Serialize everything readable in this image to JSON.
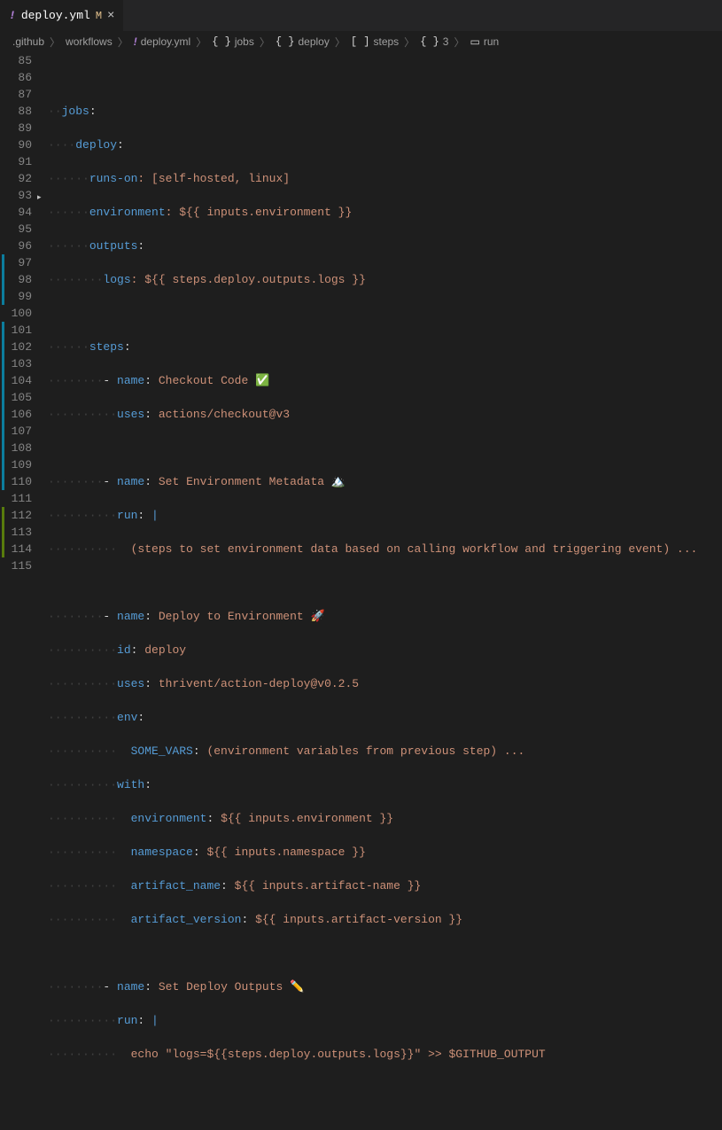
{
  "tab": {
    "icon": "!",
    "filename": "deploy.yml",
    "modified_marker": "M",
    "close": "×"
  },
  "breadcrumbs": {
    "seg1": ".github",
    "seg2": "workflows",
    "file_icon": "!",
    "seg3": "deploy.yml",
    "brace1": "{ }",
    "seg4": "jobs",
    "brace2": "{ }",
    "seg5": "deploy",
    "bracket": "[ ]",
    "seg6": "steps",
    "brace3": "{ }",
    "seg7": "3",
    "run_icon": "▭",
    "seg8": "run"
  },
  "line_numbers": [
    "85",
    "86",
    "87",
    "88",
    "89",
    "90",
    "91",
    "92",
    "93",
    "94",
    "95",
    "96",
    "97",
    "98",
    "99",
    "100",
    "101",
    "102",
    "103",
    "104",
    "105",
    "106",
    "107",
    "108",
    "109",
    "110",
    "111",
    "112",
    "113",
    "114",
    "115"
  ],
  "code": {
    "l86_key": "jobs",
    "l86_colon": ":",
    "l87_key": "deploy",
    "l87_colon": ":",
    "l88_key": "runs-on",
    "l88_val": ": [self-hosted, linux]",
    "l89_key": "environment",
    "l89_val": ": ${{ inputs.environment }}",
    "l90_key": "outputs",
    "l90_colon": ":",
    "l91_key": "logs",
    "l91_val": ": ${{ steps.deploy.outputs.logs }}",
    "l93_key": "steps",
    "l93_colon": ":",
    "l94_dash": "- ",
    "l94_key": "name",
    "l94_col": ": ",
    "l94_val": "Checkout Code ✅",
    "l95_key": "uses",
    "l95_col": ": ",
    "l95_val": "actions/checkout@v3",
    "l97_dash": "- ",
    "l97_key": "name",
    "l97_col": ": ",
    "l97_val": "Set Environment Metadata 🏔️",
    "l98_key": "run",
    "l98_col": ":",
    "l98_pipe": " |",
    "l99_val": "(steps to set environment data based on calling workflow and triggering event) ...",
    "l101_dash": "- ",
    "l101_key": "name",
    "l101_col": ": ",
    "l101_val": "Deploy to Environment 🚀",
    "l102_key": "id",
    "l102_col": ": ",
    "l102_val": "deploy",
    "l103_key": "uses",
    "l103_col": ": ",
    "l103_val": "thrivent/action-deploy@v0.2.5",
    "l104_key": "env",
    "l104_col": ":",
    "l105_key": "SOME_VARS",
    "l105_col": ": ",
    "l105_val": "(environment variables from previous step) ...",
    "l106_key": "with",
    "l106_col": ":",
    "l107_key": "environment",
    "l107_col": ": ",
    "l107_val": "${{ inputs.environment }}",
    "l108_key": "namespace",
    "l108_col": ": ",
    "l108_val": "${{ inputs.namespace }}",
    "l109_key": "artifact_name",
    "l109_col": ": ",
    "l109_val": "${{ inputs.artifact-name }}",
    "l110_key": "artifact_version",
    "l110_col": ": ",
    "l110_val": "${{ inputs.artifact-version }}",
    "l112_dash": "- ",
    "l112_key": "name",
    "l112_col": ": ",
    "l112_val": "Set Deploy Outputs ✏️",
    "l113_key": "run",
    "l113_col": ":",
    "l113_pipe": " |",
    "l114_val": "echo \"logs=${{steps.deploy.outputs.logs}}\" >> $GITHUB_OUTPUT"
  },
  "indent1": "··",
  "indent2": "····",
  "indent3": "······",
  "indent4": "········",
  "indent5": "··········"
}
